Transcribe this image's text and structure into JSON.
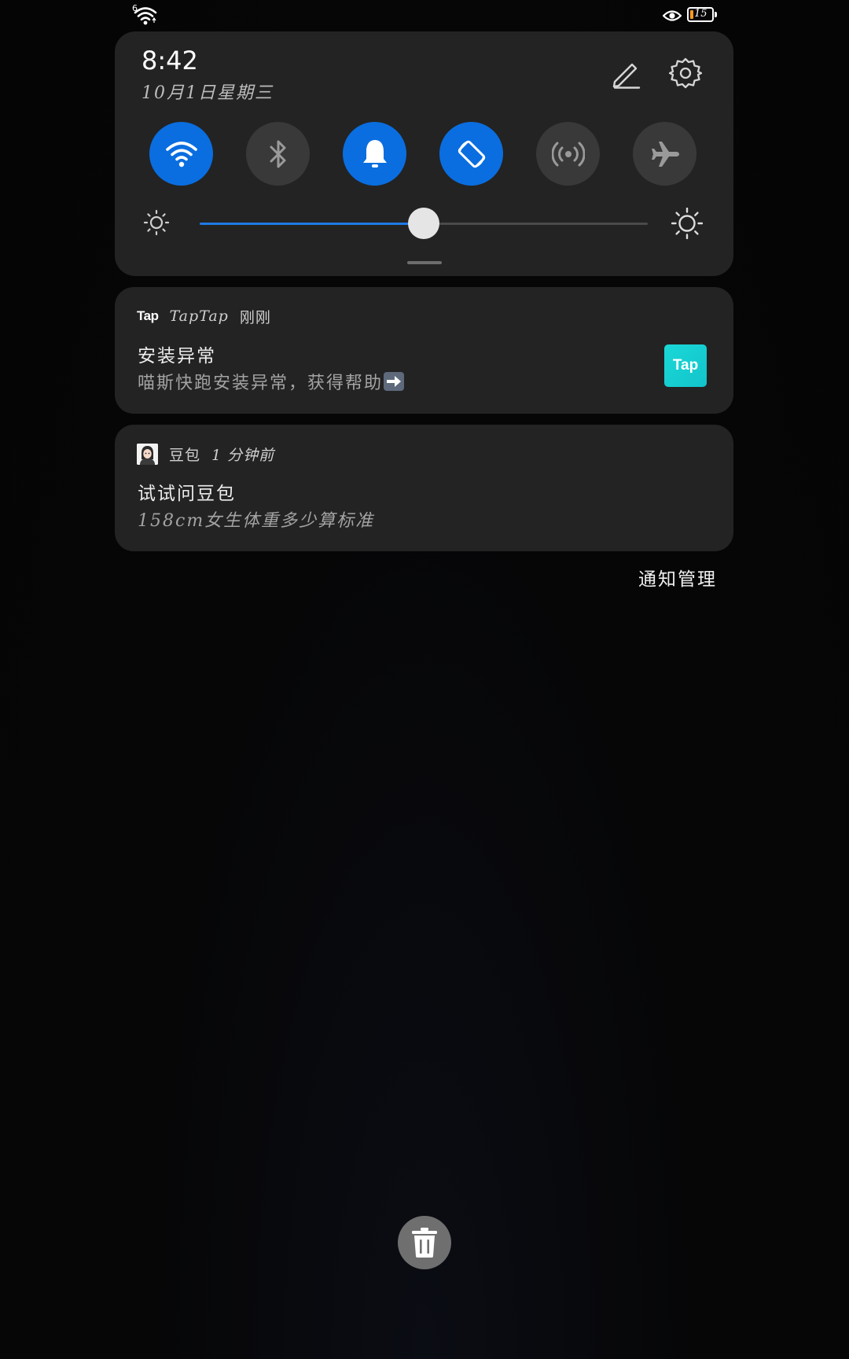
{
  "status_bar": {
    "signal_label": "6",
    "battery_level": "15",
    "battery_color": "#ff9a1f"
  },
  "quick_panel": {
    "time": "8:42",
    "date": "10月1日星期三",
    "toggles": [
      {
        "name": "wifi",
        "icon": "wifi-icon",
        "on": true
      },
      {
        "name": "bluetooth",
        "icon": "bluetooth-icon",
        "on": false
      },
      {
        "name": "sound",
        "icon": "bell-icon",
        "on": true
      },
      {
        "name": "auto-rotate",
        "icon": "rotate-icon",
        "on": true
      },
      {
        "name": "hotspot",
        "icon": "hotspot-icon",
        "on": false
      },
      {
        "name": "airplane",
        "icon": "airplane-icon",
        "on": false
      }
    ],
    "brightness_level": 0.5,
    "accent_color": "#0a6ee0"
  },
  "notifications": [
    {
      "app_icon_text": "Tap",
      "app_name": "TapTap",
      "time": "刚刚",
      "title": "安装异常",
      "body": "喵斯快跑安装异常，获得帮助",
      "thumb_text": "Tap"
    },
    {
      "app_name": "豆包",
      "time": "1 分钟前",
      "title": "试试问豆包",
      "body": "158cm女生体重多少算标准"
    }
  ],
  "notification_manage_label": "通知管理"
}
